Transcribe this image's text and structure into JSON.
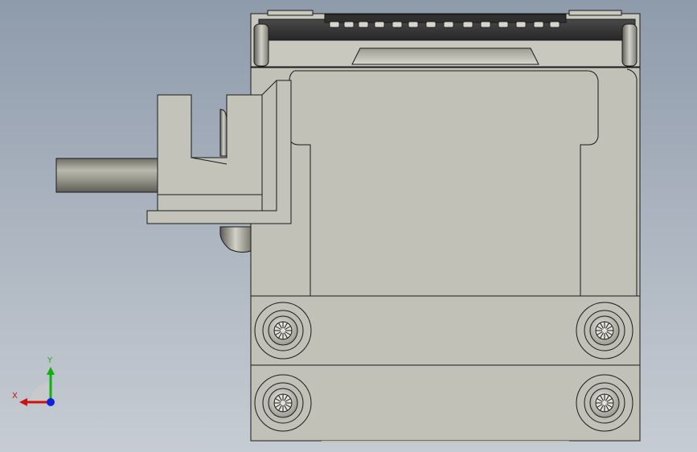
{
  "viewport": {
    "background_top": "#8e9bab",
    "background_bottom": "#c6ccd3"
  },
  "model": {
    "body_color": "#c1c1b8",
    "body_shade": "#b6b6ac",
    "edge_color": "#1a1a1a",
    "top_plate_color": "#3a3a3a",
    "shaft_color": "#8f8f84"
  },
  "triad": {
    "x_label": "X",
    "y_label": "Y",
    "x_color": "#d01010",
    "y_color": "#10b010",
    "z_color": "#1020e0"
  }
}
